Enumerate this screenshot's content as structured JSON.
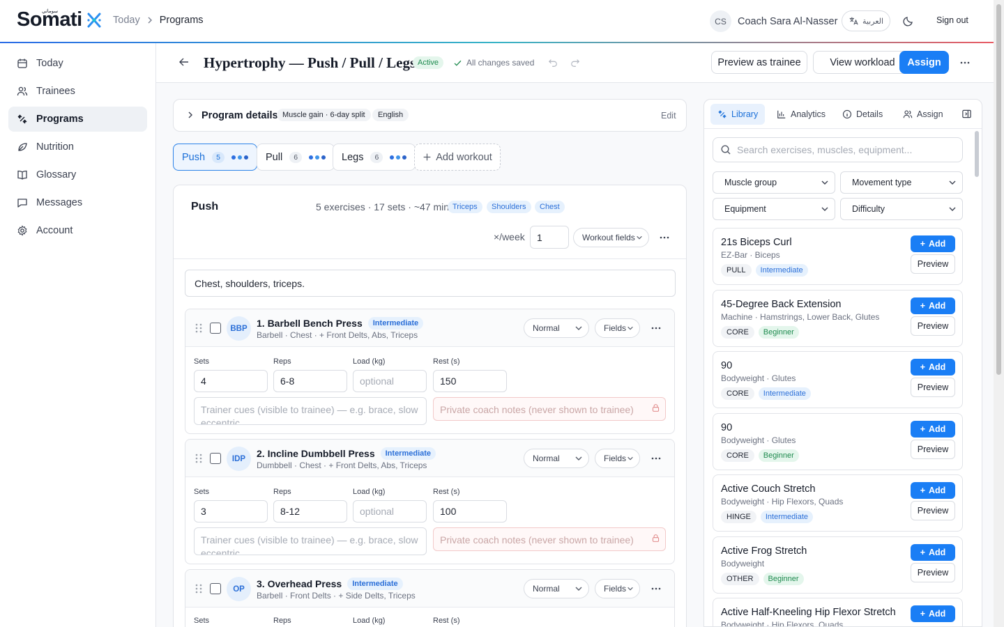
{
  "app": {
    "logo": "Somati",
    "logo_ar": "سوماتي"
  },
  "breadcrumb": {
    "home": "Today",
    "current": "Programs"
  },
  "user": {
    "initials": "CS",
    "name": "Coach Sara Al-Nasser",
    "language": "العربية",
    "sign_out": "Sign out"
  },
  "sidebar": {
    "items": [
      {
        "label": "Today",
        "icon": "calendar-icon"
      },
      {
        "label": "Trainees",
        "icon": "users-icon"
      },
      {
        "label": "Programs",
        "icon": "programs-icon",
        "active": true
      },
      {
        "label": "Nutrition",
        "icon": "nutrition-icon"
      },
      {
        "label": "Glossary",
        "icon": "book-icon"
      },
      {
        "label": "Messages",
        "icon": "message-icon"
      },
      {
        "label": "Account",
        "icon": "gear-icon"
      }
    ]
  },
  "header": {
    "title": "Hypertrophy — Push / Pull / Legs",
    "status": "Active",
    "saved": "All changes saved",
    "preview": "Preview as trainee",
    "workload": "View workload",
    "assign": "Assign"
  },
  "program_details": {
    "label": "Program details",
    "tags": [
      "Muscle gain · 6-day split",
      "English"
    ],
    "edit": "Edit"
  },
  "workout_tabs": [
    {
      "label": "Push",
      "count": "5",
      "active": true
    },
    {
      "label": "Pull",
      "count": "6"
    },
    {
      "label": "Legs",
      "count": "6"
    }
  ],
  "add_workout": "Add workout",
  "workout": {
    "name": "Push",
    "summary": "5 exercises · 17 sets · ~47 min",
    "muscles": [
      "Triceps",
      "Shoulders",
      "Chest"
    ],
    "per_week_label": "×/week",
    "per_week": "1",
    "fields_label": "Workout fields",
    "notes": "Chest, shoulders, triceps."
  },
  "field_labels": {
    "sets": "Sets",
    "reps": "Reps",
    "load": "Load (kg)",
    "rest": "Rest (s)",
    "load_placeholder": "optional",
    "cues_placeholder": "Trainer cues (visible to trainee) — e.g. brace, slow eccentric",
    "private_placeholder": "Private coach notes (never shown to trainee)",
    "mode": "Normal",
    "fields": "Fields"
  },
  "exercises": [
    {
      "abbr": "BBP",
      "name": "1. Barbell Bench Press",
      "level": "Intermediate",
      "meta": "Barbell · Chest · + Front Delts, Abs, Triceps",
      "sets": "4",
      "reps": "6-8",
      "rest": "150"
    },
    {
      "abbr": "IDP",
      "name": "2. Incline Dumbbell Press",
      "level": "Intermediate",
      "meta": "Dumbbell · Chest · + Front Delts, Abs, Triceps",
      "sets": "3",
      "reps": "8-12",
      "rest": "100"
    },
    {
      "abbr": "OP",
      "name": "3. Overhead Press",
      "level": "Intermediate",
      "meta": "Barbell · Front Delts · + Side Delts, Triceps"
    }
  ],
  "panel": {
    "tabs": [
      "Library",
      "Analytics",
      "Details",
      "Assign"
    ],
    "search_placeholder": "Search exercises, muscles, equipment...",
    "filters": [
      "Muscle group",
      "Movement type",
      "Equipment",
      "Difficulty"
    ],
    "add": "Add",
    "preview": "Preview",
    "items": [
      {
        "name": "21s Biceps Curl",
        "meta": "EZ-Bar · Biceps",
        "type": "PULL",
        "level": "Intermediate"
      },
      {
        "name": "45-Degree Back Extension",
        "meta": "Machine · Hamstrings, Lower Back, Glutes",
        "type": "CORE",
        "level": "Beginner"
      },
      {
        "name": "90",
        "meta": "Bodyweight · Glutes",
        "type": "CORE",
        "level": "Intermediate"
      },
      {
        "name": "90",
        "meta": "Bodyweight · Glutes",
        "type": "CORE",
        "level": "Beginner"
      },
      {
        "name": "Active Couch Stretch",
        "meta": "Bodyweight · Hip Flexors, Quads",
        "type": "HINGE",
        "level": "Intermediate"
      },
      {
        "name": "Active Frog Stretch",
        "meta": "Bodyweight",
        "type": "OTHER",
        "level": "Beginner"
      },
      {
        "name": "Active Half-Kneeling Hip Flexor Stretch",
        "meta": "Bodyweight · Hip Flexors, Quads"
      }
    ]
  },
  "colors": {
    "primary": "#1a7ef5",
    "beginner": "#1e8a4e",
    "intermediate": "#2b6fd8"
  }
}
